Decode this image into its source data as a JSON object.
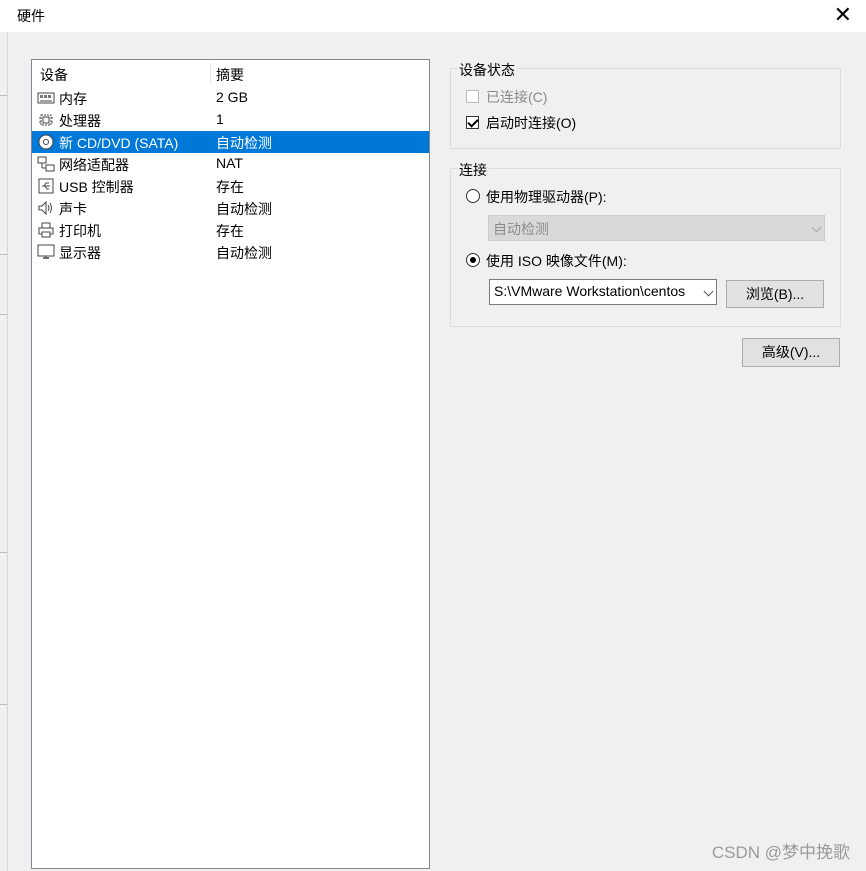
{
  "window": {
    "title": "硬件"
  },
  "device_list": {
    "headers": {
      "device": "设备",
      "summary": "摘要"
    },
    "items": [
      {
        "icon": "memory-icon",
        "name": "内存",
        "summary": "2 GB",
        "selected": false
      },
      {
        "icon": "processor-icon",
        "name": "处理器",
        "summary": "1",
        "selected": false
      },
      {
        "icon": "cd-dvd-icon",
        "name": "新 CD/DVD (SATA)",
        "summary": "自动检测",
        "selected": true
      },
      {
        "icon": "network-adapter-icon",
        "name": "网络适配器",
        "summary": "NAT",
        "selected": false
      },
      {
        "icon": "usb-icon",
        "name": "USB 控制器",
        "summary": "存在",
        "selected": false
      },
      {
        "icon": "sound-card-icon",
        "name": "声卡",
        "summary": "自动检测",
        "selected": false
      },
      {
        "icon": "printer-icon",
        "name": "打印机",
        "summary": "存在",
        "selected": false
      },
      {
        "icon": "display-icon",
        "name": "显示器",
        "summary": "自动检测",
        "selected": false
      }
    ]
  },
  "device_status": {
    "title": "设备状态",
    "connected": {
      "label": "已连接(C)",
      "checked": false,
      "enabled": false
    },
    "connect_at_power_on": {
      "label": "启动时连接(O)",
      "checked": true,
      "enabled": true
    }
  },
  "connection": {
    "title": "连接",
    "physical_drive": {
      "label": "使用物理驱动器(P):",
      "selected": false,
      "value": "自动检测"
    },
    "iso_image": {
      "label": "使用 ISO 映像文件(M):",
      "selected": true,
      "value": "S:\\VMware Workstation\\centos"
    },
    "browse_label": "浏览(B)..."
  },
  "advanced_label": "高级(V)...",
  "watermark": "CSDN @梦中挽歌",
  "colors": {
    "selection": "#0078d7",
    "dialog_bg": "#f0f0f0"
  }
}
